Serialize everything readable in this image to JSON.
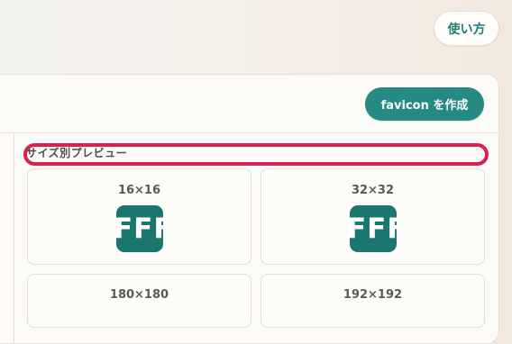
{
  "header": {
    "howto_label": "使い方"
  },
  "panel": {
    "create_label": "favicon を作成"
  },
  "preview": {
    "section_title": "サイズ別プレビュー",
    "icon_text": "FFF",
    "cards": [
      {
        "label": "16×16"
      },
      {
        "label": "32×32"
      },
      {
        "label": "180×180"
      },
      {
        "label": "192×192"
      }
    ]
  },
  "colors": {
    "accent": "#258a82",
    "icon_bg": "#1a766f",
    "highlight": "#dc1f4e"
  },
  "icons": {
    "favicon_preview": "favicon-preview-icon"
  }
}
